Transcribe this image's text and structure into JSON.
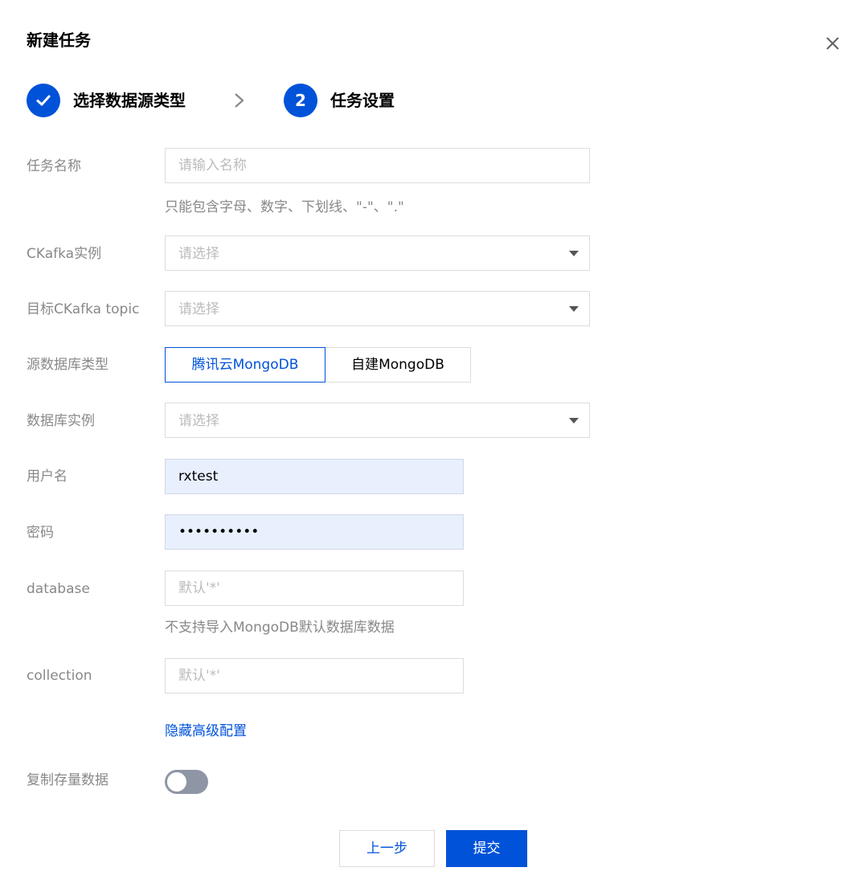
{
  "dialog": {
    "title": "新建任务"
  },
  "steps": [
    {
      "number": "✓",
      "label": "选择数据源类型",
      "status": "completed"
    },
    {
      "number": "2",
      "label": "任务设置",
      "status": "current"
    }
  ],
  "form": {
    "task_name": {
      "label": "任务名称",
      "placeholder": "请输入名称",
      "value": "",
      "hint": "只能包含字母、数字、下划线、\"-\"、\".\""
    },
    "ckafka_instance": {
      "label": "CKafka实例",
      "placeholder": "请选择"
    },
    "target_topic": {
      "label": "目标CKafka topic",
      "placeholder": "请选择"
    },
    "source_db_type": {
      "label": "源数据库类型",
      "options": [
        "腾讯云MongoDB",
        "自建MongoDB"
      ],
      "selected": "腾讯云MongoDB"
    },
    "db_instance": {
      "label": "数据库实例",
      "placeholder": "请选择"
    },
    "username": {
      "label": "用户名",
      "value": "rxtest"
    },
    "password": {
      "label": "密码",
      "value": "••••••••••"
    },
    "database": {
      "label": "database",
      "placeholder": "默认'*'",
      "hint": "不支持导入MongoDB默认数据库数据"
    },
    "collection": {
      "label": "collection",
      "placeholder": "默认'*'"
    },
    "advanced_link": "隐藏高级配置",
    "copy_existing": {
      "label": "复制存量数据",
      "enabled": false
    }
  },
  "footer": {
    "prev_label": "上一步",
    "submit_label": "提交"
  },
  "colors": {
    "primary": "#0052d9",
    "autofill": "#e8f0fe",
    "toggle_off": "#8e96a6"
  }
}
